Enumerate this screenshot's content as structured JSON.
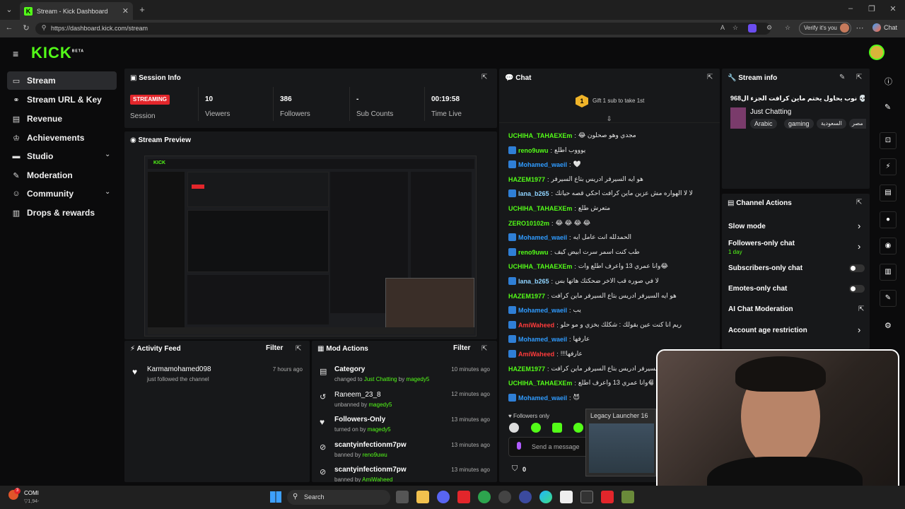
{
  "browser": {
    "tab_title": "Stream - Kick Dashboard",
    "url": "https://dashboard.kick.com/stream",
    "verify_label": "Verify it's you",
    "chat_label": "Chat"
  },
  "logo": {
    "text": "KICK",
    "tag": "BETA"
  },
  "sidebar": {
    "items": [
      {
        "label": "Stream",
        "icon": "stream-icon"
      },
      {
        "label": "Stream URL & Key",
        "icon": "link-icon"
      },
      {
        "label": "Revenue",
        "icon": "revenue-icon"
      },
      {
        "label": "Achievements",
        "icon": "trophy-icon"
      },
      {
        "label": "Studio",
        "icon": "studio-icon"
      },
      {
        "label": "Moderation",
        "icon": "wrench-icon"
      },
      {
        "label": "Community",
        "icon": "people-icon"
      },
      {
        "label": "Drops & rewards",
        "icon": "gift-icon"
      }
    ]
  },
  "session": {
    "title": "Session Info",
    "status_badge": "STREAMING",
    "status_label": "Session",
    "stats": [
      {
        "value": "10",
        "label": "Viewers"
      },
      {
        "value": "386",
        "label": "Followers"
      },
      {
        "value": "-",
        "label": "Sub Counts"
      },
      {
        "value": "00:19:58",
        "label": "Time Live"
      }
    ]
  },
  "preview": {
    "title": "Stream Preview"
  },
  "activity": {
    "title": "Activity Feed",
    "filter": "Filter",
    "items": [
      {
        "name": "Karmamohamed098",
        "desc": "just followed the channel",
        "time": "7 hours ago"
      }
    ]
  },
  "mod_actions": {
    "title": "Mod Actions",
    "filter": "Filter",
    "items": [
      {
        "title": "Category",
        "pre": "changed to ",
        "target": "Just Chatting",
        "by": " by ",
        "mod": "magedy5",
        "time": "10 minutes ago"
      },
      {
        "title": "Raneem_23_8",
        "pre": "unbanned by ",
        "target": "",
        "by": "",
        "mod": "magedy5",
        "time": "12 minutes ago"
      },
      {
        "title": "Followers-Only",
        "pre": "turned on by ",
        "target": "",
        "by": "",
        "mod": "magedy5",
        "time": "13 minutes ago"
      },
      {
        "title": "scantyinfectionm7pw",
        "pre": "banned by ",
        "target": "",
        "by": "",
        "mod": "reno9uwu",
        "time": "13 minutes ago"
      },
      {
        "title": "scantyinfectionm7pw",
        "pre": "banned by ",
        "target": "",
        "by": "",
        "mod": "AmiWaheed",
        "time": "13 minutes ago"
      }
    ]
  },
  "chat": {
    "title": "Chat",
    "gift_count": "1",
    "gift_text": "Gift 1 sub to take 1st",
    "messages": [
      {
        "user": "UCHIHA_TAHAEXEm",
        "color": "#53fc18",
        "text": "مجدي وهو صحلون 😂",
        "badge": false
      },
      {
        "user": "reno9uwu",
        "color": "#53fc18",
        "text": "يوووب اطلع",
        "badge": true
      },
      {
        "user": "Mohamed_waeil",
        "color": "#2f9bff",
        "text": "🤍",
        "badge": true
      },
      {
        "user": "HAZEM1977",
        "color": "#53fc18",
        "text": "هو ايه السيرفر ادريس بتاع السيرفر",
        "badge": false
      },
      {
        "user": "lana_b265",
        "color": "#8fd3ff",
        "text": "لا لا الهواره مش عزين ماين كرافت احكي قصه حياتك",
        "badge": true
      },
      {
        "user": "UCHIHA_TAHAEXEm",
        "color": "#53fc18",
        "text": "متعرش طلع",
        "badge": false
      },
      {
        "user": "ZERO10102m",
        "color": "#53fc18",
        "text": "😂 😂 😂 😂",
        "badge": false
      },
      {
        "user": "Mohamed_waeil",
        "color": "#2f9bff",
        "text": "الحمدلله انت عامل ايه",
        "badge": true
      },
      {
        "user": "reno9uwu",
        "color": "#53fc18",
        "text": "طب كنت اسمر سرت ابيض كيف",
        "badge": true
      },
      {
        "user": "UCHIHA_TAHAEXEm",
        "color": "#53fc18",
        "text": "😂وانا عمري 13 واعرف اطلع وات",
        "badge": false
      },
      {
        "user": "lana_b265",
        "color": "#8fd3ff",
        "text": "لا في صوره قب الاخر ضحكتك هاتها بس",
        "badge": true
      },
      {
        "user": "HAZEM1977",
        "color": "#53fc18",
        "text": "هو ايه السيرفر ادريس بتاع السيرفر ماين كرافت",
        "badge": false
      },
      {
        "user": "Mohamed_waeil",
        "color": "#2f9bff",
        "text": "يب",
        "badge": true
      },
      {
        "user": "AmiWaheed",
        "color": "#ff3b3b",
        "text": "ريم انا كنت عين بقولك : شكلك بخزي و مو حلو",
        "badge": true
      },
      {
        "user": "Mohamed_waeil",
        "color": "#2f9bff",
        "text": "عارفها",
        "badge": true
      },
      {
        "user": "AmiWaheed",
        "color": "#ff3b3b",
        "text": "عارفها!!!",
        "badge": true
      },
      {
        "user": "HAZEM1977",
        "color": "#53fc18",
        "text": "هو ايه السيرفر ادريس بتاع السيرفر ماين كرافت",
        "badge": false
      },
      {
        "user": "UCHIHA_TAHAEXEm",
        "color": "#53fc18",
        "text": "😂😂وانا عمري 13 واعرف اطلع",
        "badge": false
      },
      {
        "user": "Mohamed_waeil",
        "color": "#2f9bff",
        "text": "😈",
        "badge": true
      }
    ],
    "followers_only": "Followers only",
    "input_placeholder": "Send a message",
    "points": "0"
  },
  "stream_info": {
    "title": "Stream info",
    "stream_title": "نوب يحاول يختم ماين كرافت الجزء ال968 💀",
    "category": "Just Chatting",
    "tags": [
      "Arabic",
      "gaming",
      "السعودية",
      "مصر"
    ]
  },
  "channel_actions": {
    "title": "Channel Actions",
    "items": [
      {
        "label": "Slow mode",
        "sub": "",
        "control": "arrow"
      },
      {
        "label": "Followers-only chat",
        "sub": "1 day",
        "control": "arrow"
      },
      {
        "label": "Subscribers-only chat",
        "sub": "",
        "control": "toggle"
      },
      {
        "label": "Emotes-only chat",
        "sub": "",
        "control": "toggle"
      },
      {
        "label": "AI Chat Moderation",
        "sub": "",
        "control": "external"
      },
      {
        "label": "Account age restriction",
        "sub": "",
        "control": "arrow"
      }
    ]
  },
  "overlay": {
    "legacy_title": "Legacy Launcher 16"
  },
  "taskbar": {
    "search": "Search",
    "weather": "COMI",
    "weather_sub": "▽1,94-",
    "notif": "3"
  },
  "colors": {
    "accent": "#53fc18",
    "bg": "#0b0b0c",
    "panel": "#17181a",
    "streaming": "#e3262b"
  }
}
